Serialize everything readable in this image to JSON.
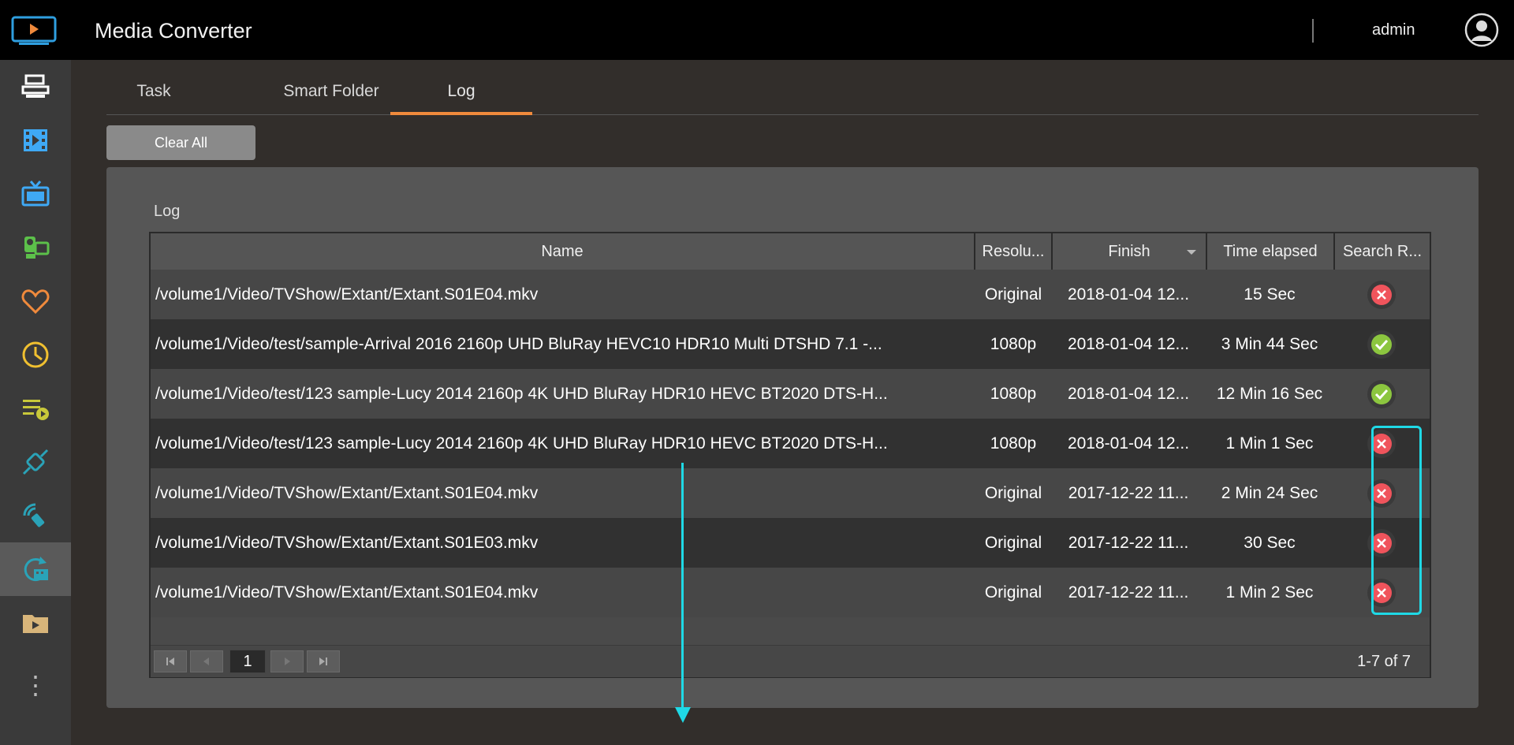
{
  "app": {
    "title": "Media Converter",
    "user": "admin"
  },
  "sidebar": {
    "items": [
      {
        "icon": "server-icon",
        "color": "#ffffff"
      },
      {
        "icon": "film-icon",
        "color": "#3fa9f5"
      },
      {
        "icon": "tv-icon",
        "color": "#3fa9f5"
      },
      {
        "icon": "camera-icon",
        "color": "#5cc04a"
      },
      {
        "icon": "heart-icon",
        "color": "#f08a3c"
      },
      {
        "icon": "clock-icon",
        "color": "#f0c030"
      },
      {
        "icon": "playlist-icon",
        "color": "#c8c83a"
      },
      {
        "icon": "plug-icon",
        "color": "#2aa3b8"
      },
      {
        "icon": "dlna-icon",
        "color": "#2aa3b8"
      },
      {
        "icon": "convert-icon",
        "color": "#2aa3b8",
        "active": true
      },
      {
        "icon": "folder-icon",
        "color": "#d8b57a"
      }
    ],
    "more": "⋮"
  },
  "tabs": [
    {
      "label": "Task"
    },
    {
      "label": "Smart Folder"
    },
    {
      "label": "Log",
      "active": true
    }
  ],
  "toolbar": {
    "clear_all": "Clear All"
  },
  "panel": {
    "title": "Log"
  },
  "table": {
    "columns": [
      "Name",
      "Resolu...",
      "Finish",
      "Time elapsed",
      "Search R..."
    ],
    "rows": [
      {
        "name": "/volume1/Video/TVShow/Extant/Extant.S01E04.mkv",
        "resolution": "Original",
        "finish": "2018-01-04 12...",
        "elapsed": "15 Sec",
        "status": "fail"
      },
      {
        "name": "/volume1/Video/test/sample-Arrival 2016 2160p UHD BluRay HEVC10 HDR10 Multi DTSHD 7.1 -...",
        "resolution": "1080p",
        "finish": "2018-01-04 12...",
        "elapsed": "3 Min 44 Sec",
        "status": "success"
      },
      {
        "name": "/volume1/Video/test/123 sample-Lucy 2014 2160p 4K UHD BluRay HDR10 HEVC BT2020 DTS-H...",
        "resolution": "1080p",
        "finish": "2018-01-04 12...",
        "elapsed": "12 Min 16 Sec",
        "status": "success"
      },
      {
        "name": "/volume1/Video/test/123 sample-Lucy 2014 2160p 4K UHD BluRay HDR10 HEVC BT2020 DTS-H...",
        "resolution": "1080p",
        "finish": "2018-01-04 12...",
        "elapsed": "1 Min 1 Sec",
        "status": "fail"
      },
      {
        "name": "/volume1/Video/TVShow/Extant/Extant.S01E04.mkv",
        "resolution": "Original",
        "finish": "2017-12-22 11...",
        "elapsed": "2 Min 24 Sec",
        "status": "fail"
      },
      {
        "name": "/volume1/Video/TVShow/Extant/Extant.S01E03.mkv",
        "resolution": "Original",
        "finish": "2017-12-22 11...",
        "elapsed": "30 Sec",
        "status": "fail"
      },
      {
        "name": "/volume1/Video/TVShow/Extant/Extant.S01E04.mkv",
        "resolution": "Original",
        "finish": "2017-12-22 11...",
        "elapsed": "1 Min 2 Sec",
        "status": "fail"
      }
    ]
  },
  "pager": {
    "page": "1",
    "info": "1-7 of 7"
  },
  "annotation_color": "#1fd9e6",
  "status_colors": {
    "fail": "#f0545c",
    "success": "#8cc63f"
  }
}
